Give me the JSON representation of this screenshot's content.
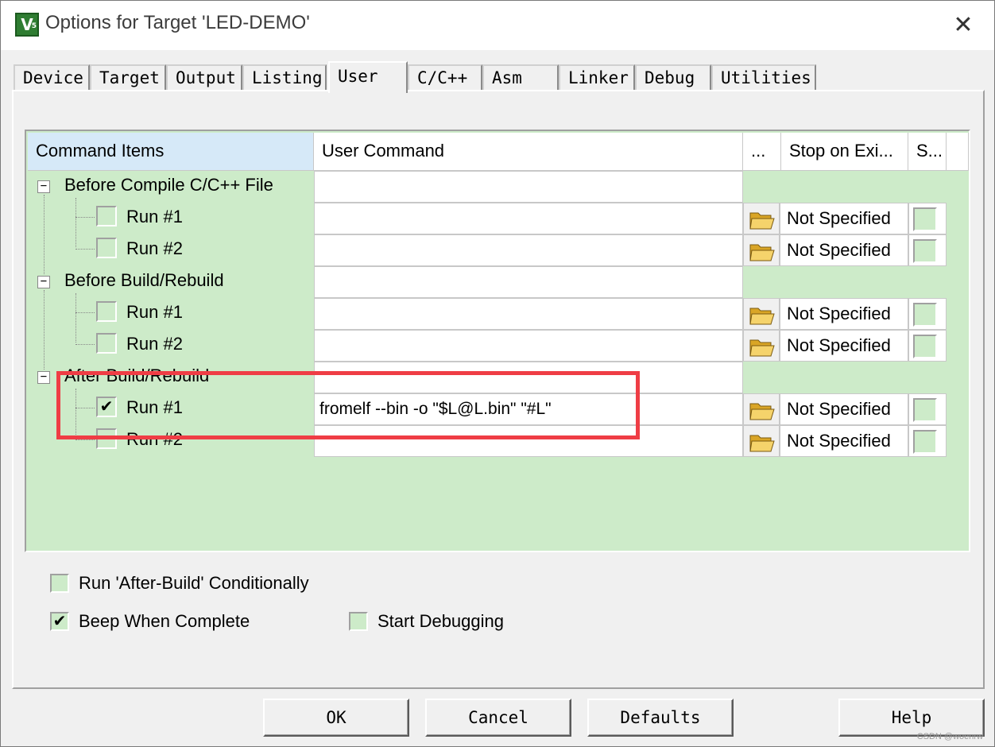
{
  "window": {
    "title": "Options for Target 'LED-DEMO'",
    "app_icon_letter": "V",
    "app_icon_sub": "5",
    "close_glyph": "✕"
  },
  "tabs": [
    {
      "label": "Device"
    },
    {
      "label": "Target"
    },
    {
      "label": "Output"
    },
    {
      "label": "Listing"
    },
    {
      "label": "User",
      "active": true
    },
    {
      "label": "C/C++"
    },
    {
      "label": "Asm"
    },
    {
      "label": "Linker"
    },
    {
      "label": "Debug"
    },
    {
      "label": "Utilities"
    }
  ],
  "grid": {
    "headers": {
      "command_items": "Command Items",
      "user_command": "User Command",
      "browse": "...",
      "stop_on_exit": "Stop on Exi...",
      "s": "S..."
    },
    "groups": [
      {
        "label": "Before Compile C/C++ File",
        "expander": "−",
        "runs": [
          {
            "label": "Run #1",
            "checked": false,
            "command": "",
            "stop": "Not Specified"
          },
          {
            "label": "Run #2",
            "checked": false,
            "command": "",
            "stop": "Not Specified"
          }
        ]
      },
      {
        "label": "Before Build/Rebuild",
        "expander": "−",
        "runs": [
          {
            "label": "Run #1",
            "checked": false,
            "command": "",
            "stop": "Not Specified"
          },
          {
            "label": "Run #2",
            "checked": false,
            "command": "",
            "stop": "Not Specified"
          }
        ]
      },
      {
        "label": "After Build/Rebuild",
        "expander": "−",
        "runs": [
          {
            "label": "Run #1",
            "checked": true,
            "command": "fromelf --bin -o \"$L@L.bin\" \"#L\"",
            "stop": "Not Specified"
          },
          {
            "label": "Run #2",
            "checked": false,
            "command": "",
            "stop": "Not Specified"
          }
        ]
      }
    ]
  },
  "options": {
    "run_after_build_conditionally": {
      "label": "Run 'After-Build' Conditionally",
      "checked": false
    },
    "beep_when_complete": {
      "label": "Beep When Complete",
      "checked": true
    },
    "start_debugging": {
      "label": "Start Debugging",
      "checked": false
    }
  },
  "check_glyph": "✔",
  "buttons": {
    "ok": "OK",
    "cancel": "Cancel",
    "defaults": "Defaults",
    "help": "Help"
  },
  "watermark": "CSDN @woenrw",
  "colors": {
    "grid_bg": "#cdebc9",
    "header_first_bg": "#d6e9f8",
    "highlight_red": "#ef3d45",
    "window_bg": "#f0f0f0"
  }
}
